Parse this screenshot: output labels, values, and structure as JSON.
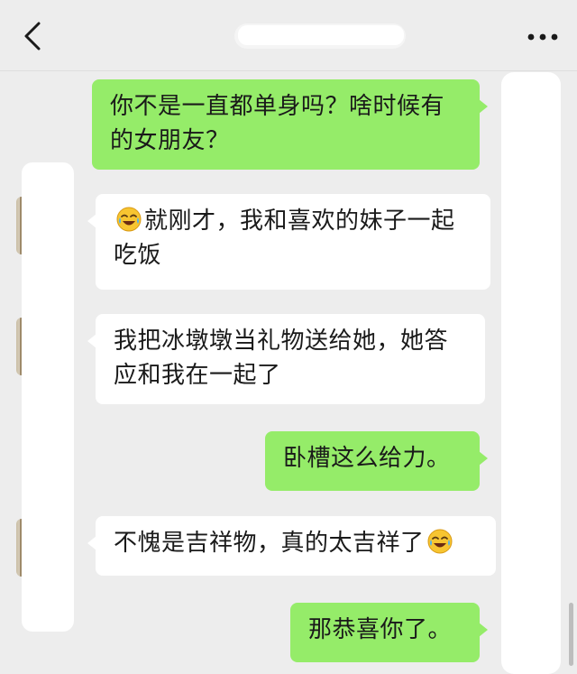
{
  "header": {
    "back_icon": "chevron-left-icon",
    "title": "",
    "more_icon": "more-dots-icon"
  },
  "messages": [
    {
      "side": "sent",
      "text": "你不是一直都单身吗？啥时候有的女朋友？"
    },
    {
      "side": "recv",
      "emoji": "face-with-tears-of-joy",
      "text": "就刚才，我和喜欢的妹子一起吃饭"
    },
    {
      "side": "recv",
      "text": "我把冰墩墩当礼物送给她，她答应和我在一起了"
    },
    {
      "side": "sent",
      "text": "卧槽这么给力。"
    },
    {
      "side": "recv",
      "text": "不愧是吉祥物，真的太吉祥了",
      "emoji_after": "face-with-tears-of-joy"
    },
    {
      "side": "sent",
      "text": "那恭喜你了。"
    }
  ],
  "colors": {
    "background": "#ededed",
    "sent_bubble": "#95ec69",
    "recv_bubble": "#ffffff",
    "text": "#1a1a1a"
  }
}
